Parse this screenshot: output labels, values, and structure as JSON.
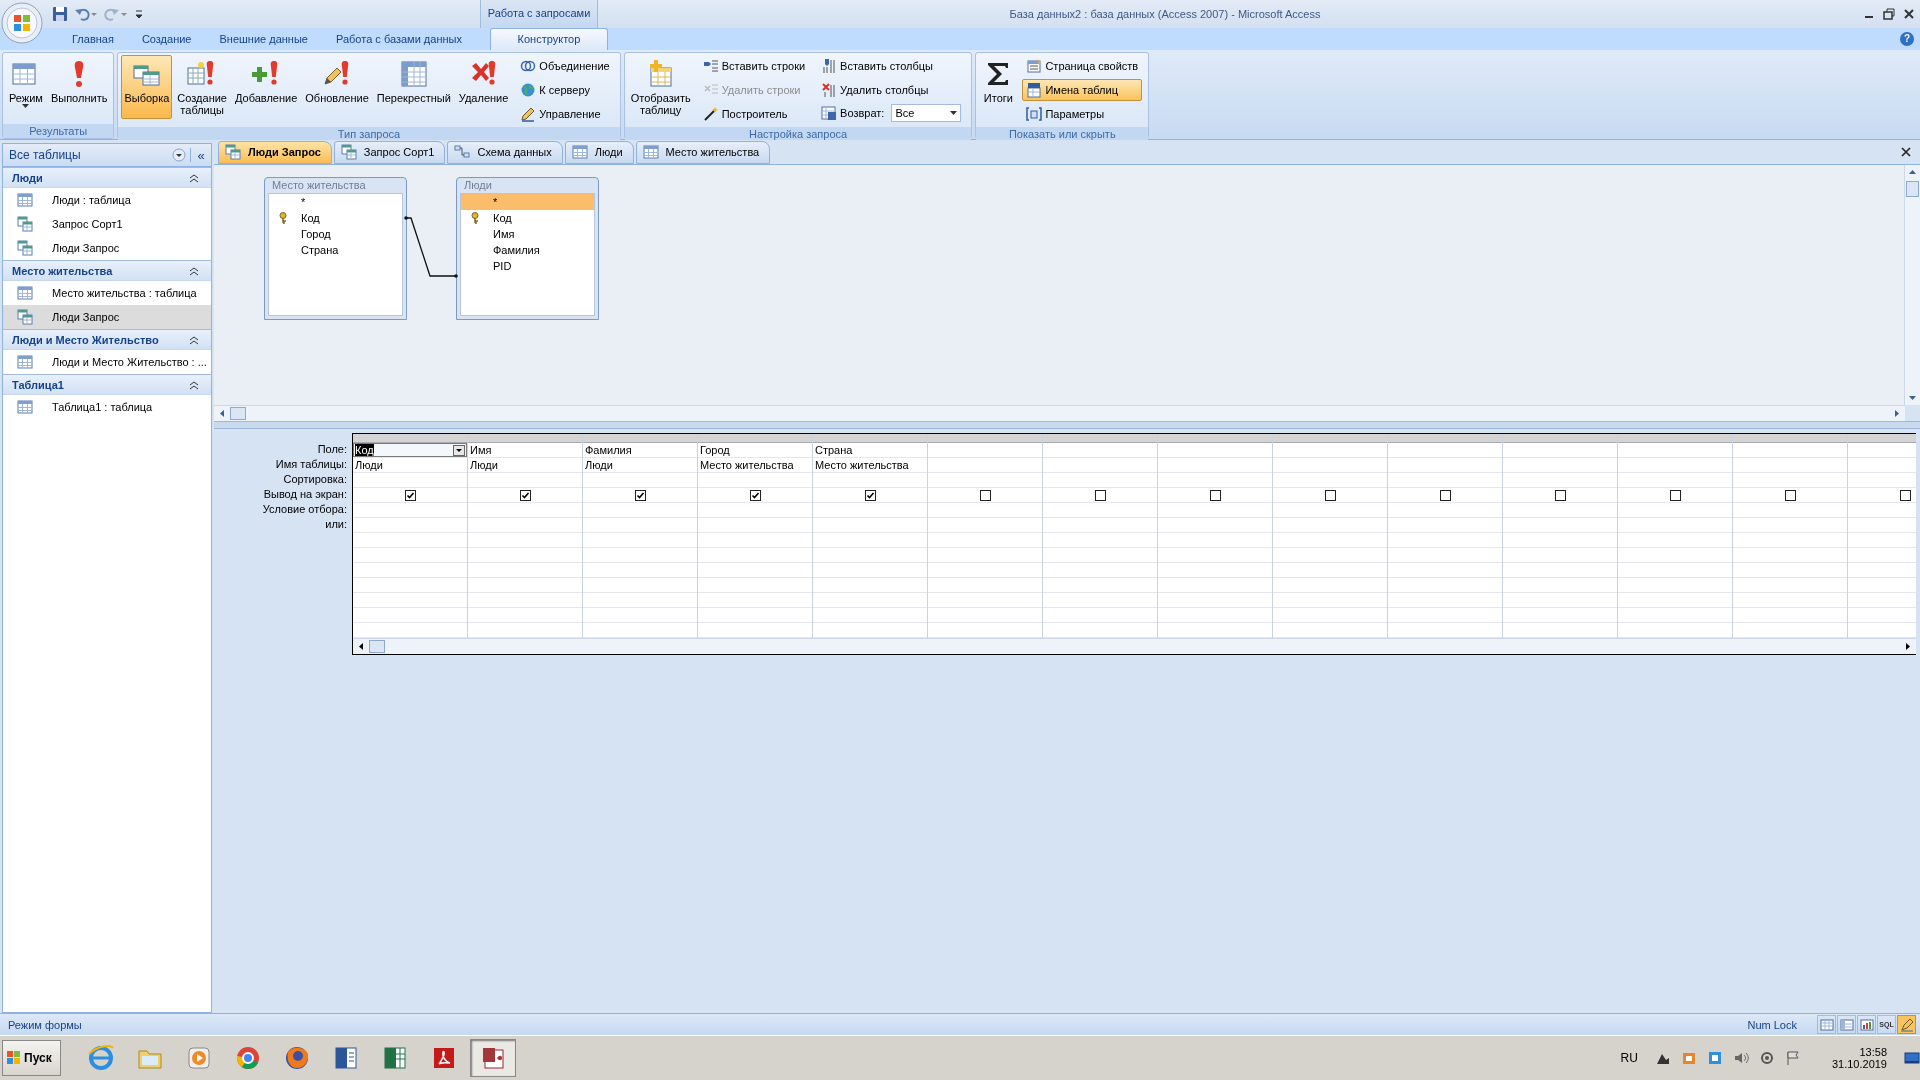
{
  "window": {
    "title": "База данных2 : база данных (Access 2007) - Microsoft Access",
    "context_tab_group": "Работа с запросами",
    "help": "?"
  },
  "ribbon_tabs": [
    {
      "label": "Главная",
      "selected": false
    },
    {
      "label": "Создание",
      "selected": false
    },
    {
      "label": "Внешние данные",
      "selected": false
    },
    {
      "label": "Работа с базами данных",
      "selected": false
    },
    {
      "label": "Конструктор",
      "selected": true
    }
  ],
  "ribbon_groups": [
    {
      "label": "Результаты",
      "items": [
        {
          "kind": "large",
          "label": "Режим",
          "selected": false,
          "dropdown": true
        },
        {
          "kind": "large",
          "label": "Выполнить",
          "selected": false,
          "dropdown": false
        }
      ]
    },
    {
      "label": "Тип запроса",
      "items": [
        {
          "kind": "large",
          "label": "Выборка",
          "selected": true,
          "dropdown": false
        },
        {
          "kind": "large",
          "label": "Создание таблицы",
          "selected": false,
          "dropdown": false
        },
        {
          "kind": "large",
          "label": "Добавление",
          "selected": false,
          "dropdown": false
        },
        {
          "kind": "large",
          "label": "Обновление",
          "selected": false,
          "dropdown": false
        },
        {
          "kind": "large",
          "label": "Перекрестный",
          "selected": false,
          "dropdown": false
        },
        {
          "kind": "large",
          "label": "Удаление",
          "selected": false,
          "dropdown": false
        },
        {
          "kind": "small",
          "label": "Объединение",
          "selected": false,
          "disabled": false
        },
        {
          "kind": "small",
          "label": "К серверу",
          "selected": false,
          "disabled": false
        },
        {
          "kind": "small",
          "label": "Управление",
          "selected": false,
          "disabled": false
        }
      ]
    },
    {
      "label": "Настройка запроса",
      "items": [
        {
          "kind": "large",
          "label": "Отобразить таблицу",
          "selected": false,
          "dropdown": false
        },
        {
          "kind": "small",
          "label": "Вставить строки",
          "selected": false,
          "disabled": false
        },
        {
          "kind": "small",
          "label": "Удалить строки",
          "selected": false,
          "disabled": true
        },
        {
          "kind": "small",
          "label": "Построитель",
          "selected": false,
          "disabled": false
        },
        {
          "kind": "small",
          "label": "Вставить столбцы",
          "selected": false,
          "disabled": false
        },
        {
          "kind": "small",
          "label": "Удалить столбцы",
          "selected": false,
          "disabled": false
        },
        {
          "kind": "combo",
          "label": "Возврат:",
          "value": "Все",
          "selected": false,
          "disabled": false
        }
      ]
    },
    {
      "label": "Показать или скрыть",
      "items": [
        {
          "kind": "large",
          "label": "Итоги",
          "selected": false,
          "dropdown": false
        },
        {
          "kind": "small",
          "label": "Страница свойств",
          "selected": false,
          "disabled": false
        },
        {
          "kind": "small",
          "label": "Имена таблиц",
          "selected": true,
          "disabled": false
        },
        {
          "kind": "small",
          "label": "Параметры",
          "selected": false,
          "disabled": false
        }
      ]
    }
  ],
  "navigation_pane": {
    "title": "Все таблицы",
    "collapse": "«",
    "groups": [
      {
        "title": "Люди",
        "expanded": true,
        "items": [
          {
            "kind": "table",
            "label": "Люди : таблица",
            "selected": false
          },
          {
            "kind": "query",
            "label": "Запрос Сорт1",
            "selected": false
          },
          {
            "kind": "query",
            "label": "Люди Запрос",
            "selected": false
          }
        ]
      },
      {
        "title": "Место жительства",
        "expanded": true,
        "items": [
          {
            "kind": "table",
            "label": "Место жительства : таблица",
            "selected": false
          },
          {
            "kind": "query",
            "label": "Люди Запрос",
            "selected": true
          }
        ]
      },
      {
        "title": "Люди и Место Жительство",
        "expanded": true,
        "items": [
          {
            "kind": "table",
            "label": "Люди и Место Жительство : ...",
            "selected": false
          }
        ]
      },
      {
        "title": "Таблица1",
        "expanded": true,
        "items": [
          {
            "kind": "table",
            "label": "Таблица1 : таблица",
            "selected": false
          }
        ]
      }
    ]
  },
  "document_tabs": [
    {
      "kind": "query",
      "label": "Люди Запрос",
      "selected": true
    },
    {
      "kind": "query",
      "label": "Запрос Сорт1",
      "selected": false
    },
    {
      "kind": "relationships",
      "label": "Схема данных",
      "selected": false
    },
    {
      "kind": "table",
      "label": "Люди",
      "selected": false
    },
    {
      "kind": "table",
      "label": "Место жительства",
      "selected": false
    }
  ],
  "query_tables": [
    {
      "title": "Место жительства",
      "fields": [
        {
          "label": "*",
          "key": false,
          "selected": false
        },
        {
          "label": "Код",
          "key": true,
          "selected": false
        },
        {
          "label": "Город",
          "key": false,
          "selected": false
        },
        {
          "label": "Страна",
          "key": false,
          "selected": false
        }
      ]
    },
    {
      "title": "Люди",
      "fields": [
        {
          "label": "*",
          "key": false,
          "selected": true
        },
        {
          "label": "Код",
          "key": true,
          "selected": false
        },
        {
          "label": "Имя",
          "key": false,
          "selected": false
        },
        {
          "label": "Фамилия",
          "key": false,
          "selected": false
        },
        {
          "label": "PID",
          "key": false,
          "selected": false
        }
      ]
    }
  ],
  "grid": {
    "row_labels": [
      "Поле:",
      "Имя таблицы:",
      "Сортировка:",
      "Вывод на экран:",
      "Условие отбора:",
      "или:"
    ],
    "columns": [
      {
        "field": "Код",
        "table": "Люди",
        "show": true,
        "selected": true
      },
      {
        "field": "Имя",
        "table": "Люди",
        "show": true,
        "selected": false
      },
      {
        "field": "Фамилия",
        "table": "Люди",
        "show": true,
        "selected": false
      },
      {
        "field": "Город",
        "table": "Место жительства",
        "show": true,
        "selected": false
      },
      {
        "field": "Страна",
        "table": "Место жительства",
        "show": true,
        "selected": false
      },
      {
        "show": false,
        "selected": false
      },
      {
        "show": false,
        "selected": false
      },
      {
        "show": false,
        "selected": false
      },
      {
        "show": false,
        "selected": false
      },
      {
        "show": false,
        "selected": false
      },
      {
        "show": false,
        "selected": false
      },
      {
        "show": false,
        "selected": false
      },
      {
        "show": false,
        "selected": false
      },
      {
        "show": false,
        "selected": false
      }
    ]
  },
  "status_bar": {
    "left": "Режим формы",
    "right": "Num Lock",
    "views": [
      {
        "kind": "datasheet",
        "selected": false
      },
      {
        "kind": "pivot",
        "selected": false
      },
      {
        "kind": "chart",
        "selected": false
      },
      {
        "kind": "sql",
        "label": "SQL",
        "selected": false
      },
      {
        "kind": "design",
        "selected": true
      }
    ]
  },
  "taskbar": {
    "start": "Пуск",
    "apps": [
      {
        "kind": "web",
        "selected": false
      },
      {
        "kind": "folder",
        "selected": false
      },
      {
        "kind": "player",
        "selected": false
      },
      {
        "kind": "browser",
        "selected": false
      },
      {
        "kind": "browser2",
        "selected": false
      },
      {
        "kind": "word",
        "selected": false
      },
      {
        "kind": "sheet",
        "selected": false
      },
      {
        "kind": "pdf",
        "selected": false
      },
      {
        "kind": "database",
        "selected": true
      }
    ],
    "language": "RU",
    "time": "13:58",
    "date": "31.10.2019"
  }
}
